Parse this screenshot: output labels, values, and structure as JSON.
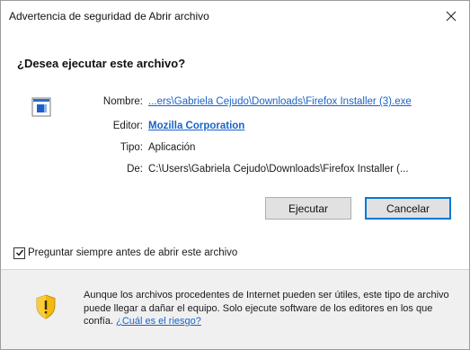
{
  "window": {
    "title": "Advertencia de seguridad de Abrir archivo",
    "close_label": "×"
  },
  "question": "¿Desea ejecutar este archivo?",
  "info": {
    "name_label": "Nombre:",
    "name_value": "...ers\\Gabriela Cejudo\\Downloads\\Firefox Installer (3).exe",
    "publisher_label": "Editor:",
    "publisher_value": "Mozilla Corporation",
    "type_label": "Tipo:",
    "type_value": "Aplicación",
    "from_label": "De:",
    "from_value": "C:\\Users\\Gabriela Cejudo\\Downloads\\Firefox Installer (..."
  },
  "buttons": {
    "run_label": "Ejecutar",
    "cancel_label": "Cancelar"
  },
  "checkbox": {
    "label": "Preguntar siempre antes de abrir este archivo",
    "checked": true
  },
  "footer": {
    "warning_text": "Aunque los archivos procedentes de Internet pueden ser útiles, este tipo de archivo puede llegar a dañar el equipo. Solo ejecute software de los editores en los que confía.",
    "risk_link": "¿Cuál es el riesgo?"
  },
  "icons": {
    "file": "application-file-icon",
    "close": "close-icon",
    "shield": "security-shield-icon",
    "checkmark": "checkmark-icon"
  },
  "colors": {
    "link": "#1a63c9",
    "default_button_border": "#0078d7",
    "footer_bg": "#f0f0f0",
    "shield_yellow": "#f2b90f"
  }
}
